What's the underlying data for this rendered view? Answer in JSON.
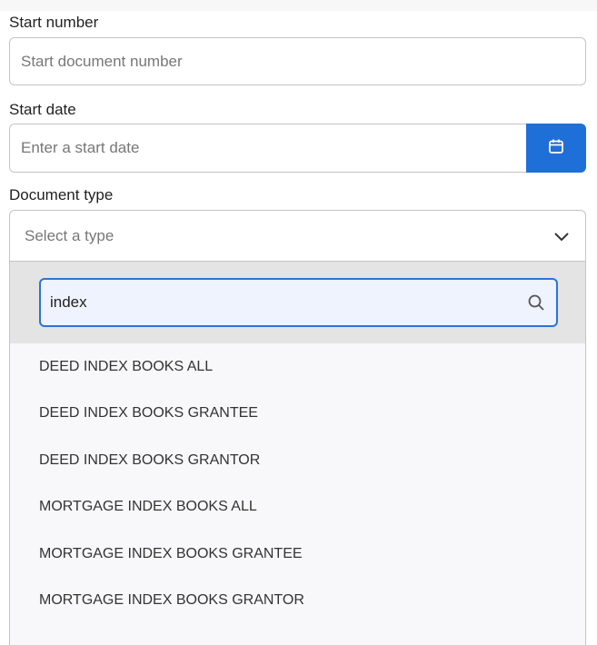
{
  "form": {
    "start_number": {
      "label": "Start number",
      "placeholder": "Start document number",
      "value": ""
    },
    "start_date": {
      "label": "Start date",
      "placeholder": "Enter a start date",
      "value": "",
      "button_icon": "calendar-icon"
    },
    "document_type": {
      "label": "Document type",
      "selected": "Select a type",
      "chevron_icon": "chevron-down-icon",
      "search": {
        "value": "index",
        "icon": "search-icon"
      },
      "options": [
        "DEED INDEX BOOKS ALL",
        "DEED INDEX BOOKS GRANTEE",
        "DEED INDEX BOOKS GRANTOR",
        "MORTGAGE INDEX BOOKS ALL",
        "MORTGAGE INDEX BOOKS GRANTEE",
        "MORTGAGE INDEX BOOKS GRANTOR"
      ]
    }
  },
  "colors": {
    "accent": "#1f6fd8",
    "focus_border": "#2a74d6",
    "focus_bg": "#eef3fd",
    "dropdown_header_bg": "#e4e4e4",
    "dropdown_bg": "#f8f8fa"
  }
}
